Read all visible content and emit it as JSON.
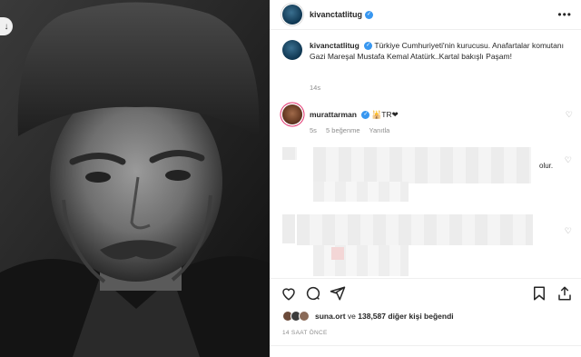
{
  "post": {
    "author": "kivanctatlitug",
    "verified_mark": "✓",
    "more_label": "•••"
  },
  "caption": {
    "author": "kivanctatlitug",
    "text": "Türkiye Cumhuriyeti'nin kurucusu. Anafartalar komutanı Gazi Mareşal Mustafa Kemal Atatürk..Kartal bakışlı Paşam!",
    "time": "14s"
  },
  "comment": {
    "author": "murattarman",
    "emoji": "🕌TR❤",
    "time": "5s",
    "likes": "5 beğenme",
    "reply": "Yanıtla"
  },
  "blurred_fragments": {
    "c2_end": "olur."
  },
  "likes": {
    "first_user": "suna.ort",
    "connector": "ve",
    "count": "138,587",
    "rest": "diğer kişi beğendi"
  },
  "timestamp": "14 SAAT ÖNCE",
  "icons": [
    "download-icon",
    "verified-icon",
    "more-icon",
    "heart-icon",
    "comment-icon",
    "share-icon",
    "save-icon",
    "upload-icon"
  ],
  "colors": {
    "verified": "#3897f0",
    "meta": "#8e8e8e",
    "photo_bg": "#1c1c1c"
  }
}
